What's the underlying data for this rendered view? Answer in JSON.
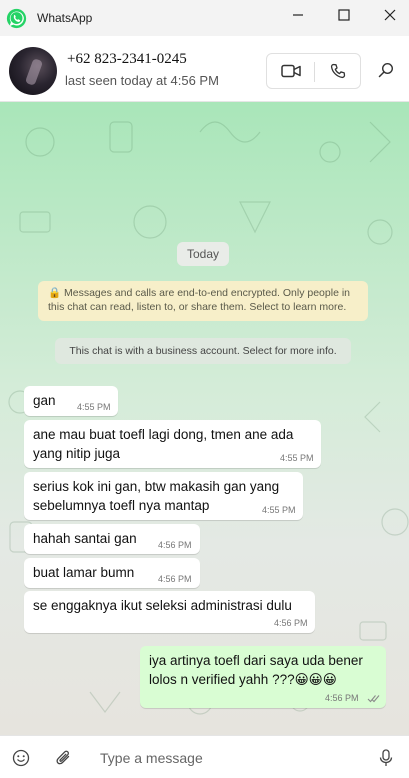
{
  "window": {
    "title": "WhatsApp",
    "minimize_glyph": "─",
    "maximize_glyph": "☐",
    "close_glyph": "✕"
  },
  "header": {
    "contact_name": "+62 823-2341-0245",
    "status": "last seen today at 4:56 PM"
  },
  "chat": {
    "date_chip": "Today",
    "encryption_notice": "🔒 Messages and calls are end-to-end encrypted. Only people in this chat can read, listen to, or share them. Select to learn more.",
    "business_notice": "This chat is with a business account. Select for more info.",
    "messages": [
      {
        "direction": "in",
        "text": "gan",
        "time": "4:55 PM"
      },
      {
        "direction": "in",
        "text": "ane mau buat toefl lagi dong, tmen ane ada yang nitip juga",
        "time": "4:55 PM"
      },
      {
        "direction": "in",
        "text": "serius kok ini gan, btw makasih gan yang sebelumnya toefl nya mantap",
        "time": "4:55 PM"
      },
      {
        "direction": "in",
        "text": "hahah santai gan",
        "time": "4:56 PM"
      },
      {
        "direction": "in",
        "text": "buat lamar bumn",
        "time": "4:56 PM"
      },
      {
        "direction": "in",
        "text": "se enggaknya ikut seleksi administrasi dulu",
        "time": "4:56 PM"
      },
      {
        "direction": "out",
        "text": "iya artinya toefl dari saya uda bener lolos n verified yahh ???😀😀😀",
        "time": "4:56 PM",
        "status": "read"
      }
    ]
  },
  "composer": {
    "placeholder": "Type a message"
  },
  "colors": {
    "brand_green": "#25d366",
    "outgoing_bubble": "#d9fdd3",
    "read_tick": "#53bdeb"
  },
  "icons": [
    "whatsapp-logo-icon",
    "video-call-icon",
    "voice-call-icon",
    "search-icon",
    "emoji-icon",
    "attach-icon",
    "mic-icon",
    "double-check-icon"
  ]
}
